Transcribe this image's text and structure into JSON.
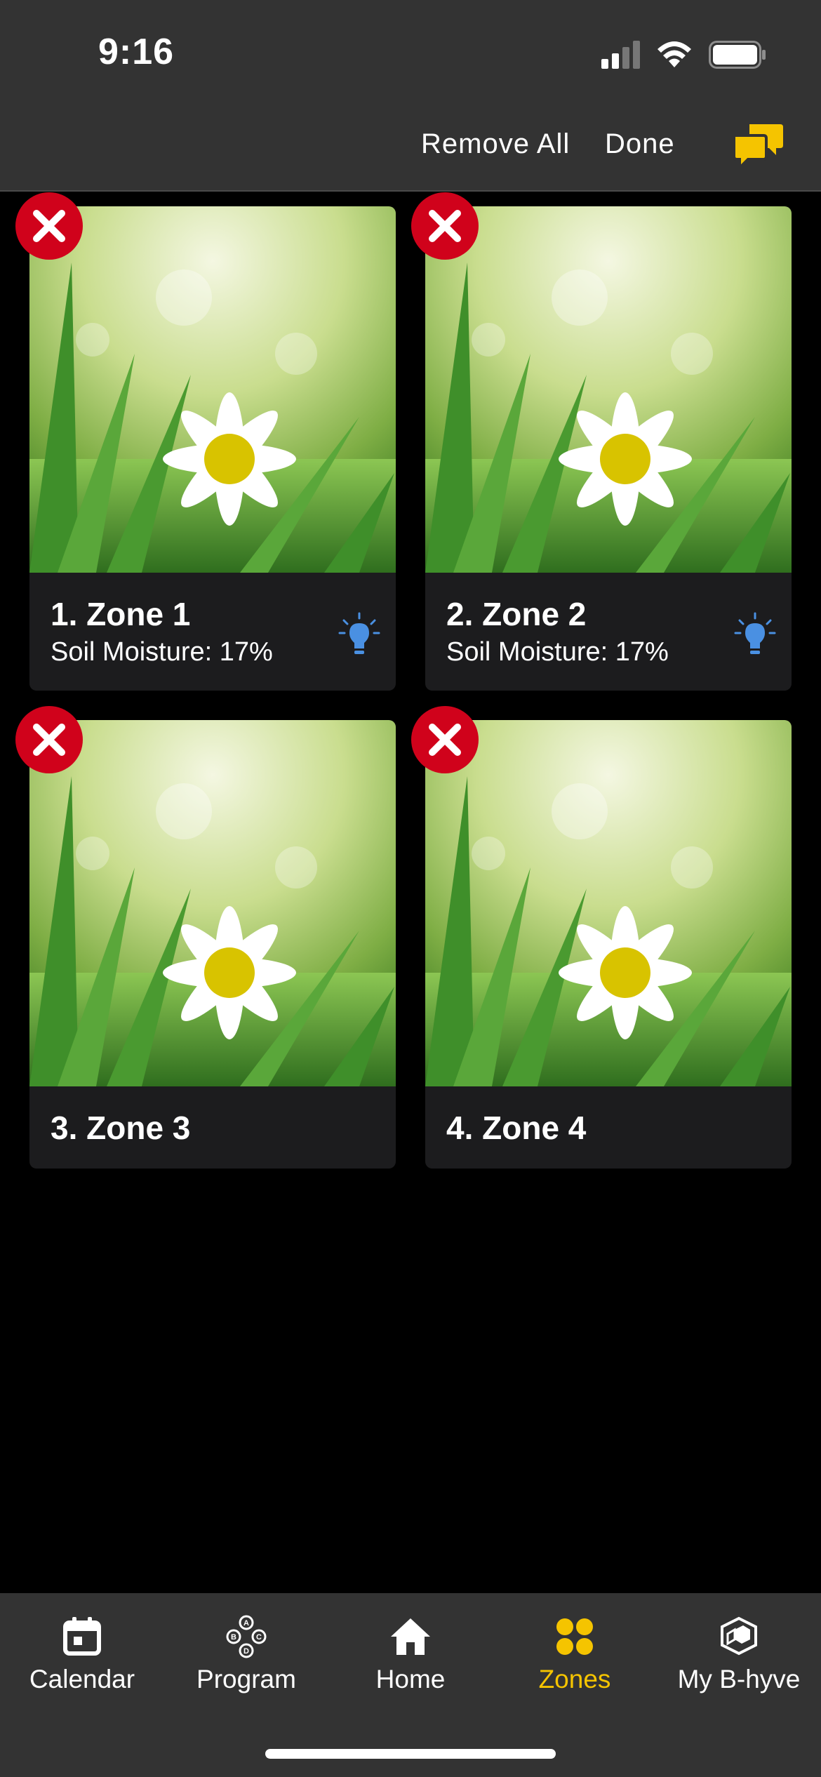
{
  "status_bar": {
    "time": "9:16"
  },
  "nav": {
    "remove_all_label": "Remove All",
    "done_label": "Done",
    "chat_icon": "chat-bubbles-icon"
  },
  "zones": [
    {
      "name": "1. Zone 1",
      "moisture": "Soil Moisture: 17%",
      "has_bulb": true
    },
    {
      "name": "2. Zone 2",
      "moisture": "Soil Moisture: 17%",
      "has_bulb": true
    },
    {
      "name": "3. Zone 3",
      "moisture": "",
      "has_bulb": false
    },
    {
      "name": "4. Zone 4",
      "moisture": "",
      "has_bulb": false
    }
  ],
  "tabs": [
    {
      "label": "Calendar",
      "icon": "calendar-icon",
      "active": false
    },
    {
      "label": "Program",
      "icon": "program-icon",
      "active": false
    },
    {
      "label": "Home",
      "icon": "home-icon",
      "active": false
    },
    {
      "label": "Zones",
      "icon": "zones-icon",
      "active": true
    },
    {
      "label": "My B-hyve",
      "icon": "bhyve-icon",
      "active": false
    }
  ],
  "colors": {
    "accent": "#f5c400",
    "remove": "#d0021b",
    "bulb": "#4a90e2",
    "bar": "#333333",
    "card": "#1c1c1e"
  }
}
